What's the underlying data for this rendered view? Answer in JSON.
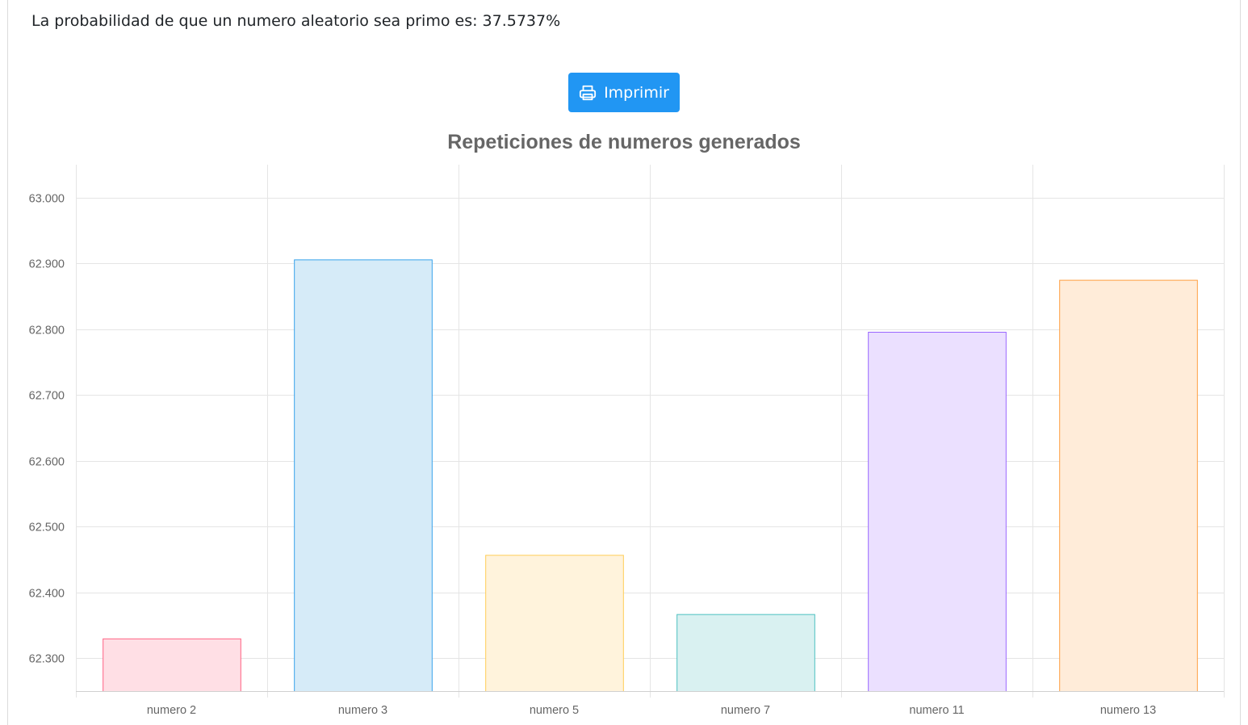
{
  "header": {
    "probability_text": "La probabilidad de que un numero aleatorio sea primo es: 37.5737%"
  },
  "toolbar": {
    "print_label": "Imprimir",
    "print_icon": "printer-icon",
    "print_color": "#2196f3"
  },
  "chart_data": {
    "type": "bar",
    "title": "Repeticiones de numeros generados",
    "xlabel": "",
    "ylabel": "",
    "categories": [
      "numero 2",
      "numero 3",
      "numero 5",
      "numero 7",
      "numero 11",
      "numero 13"
    ],
    "values": [
      62330,
      62906,
      62457,
      62367,
      62796,
      62875
    ],
    "ylim": [
      62250,
      63050
    ],
    "yticks": [
      63000,
      62900,
      62800,
      62700,
      62600,
      62500,
      62400,
      62300
    ],
    "ytick_labels": [
      "63.000",
      "62.900",
      "62.800",
      "62.700",
      "62.600",
      "62.500",
      "62.400",
      "62.300"
    ],
    "grid": true,
    "legend": "none",
    "fill_colors": [
      "#ffdfe5",
      "#d6ebf8",
      "#fff3dc",
      "#d9f1f1",
      "#ebe0ff",
      "#ffecd9"
    ],
    "border_colors": [
      "#ff6384",
      "#36a2eb",
      "#ffcd56",
      "#4bc0c0",
      "#9966ff",
      "#ff9f40"
    ]
  }
}
